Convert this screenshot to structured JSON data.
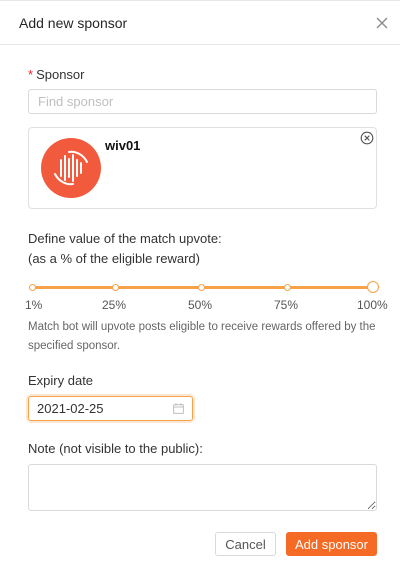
{
  "modal": {
    "title": "Add new sponsor",
    "close_icon": "close-icon"
  },
  "sponsor": {
    "label": "Sponsor",
    "required_mark": "*",
    "search_placeholder": "Find sponsor",
    "selected": {
      "name": "wiv01",
      "avatar_color": "#f25a3e",
      "remove_icon": "remove-circle-icon"
    }
  },
  "match": {
    "label_line1": "Define value of the match upvote:",
    "label_line2": "(as a % of the eligible reward)",
    "marks": [
      "1%",
      "25%",
      "50%",
      "75%",
      "100%"
    ],
    "value_percent": 100,
    "help": "Match bot will upvote posts eligible to receive rewards offered by the specified sponsor."
  },
  "expiry": {
    "label": "Expiry date",
    "value": "2021-02-25",
    "calendar_icon": "calendar-icon"
  },
  "note": {
    "label": "Note (not visible to the public):",
    "value": ""
  },
  "footer": {
    "cancel_label": "Cancel",
    "submit_label": "Add sponsor"
  },
  "colors": {
    "accent": "#f5a24a",
    "primary_button": "#f56a25",
    "required": "#f5222d"
  }
}
